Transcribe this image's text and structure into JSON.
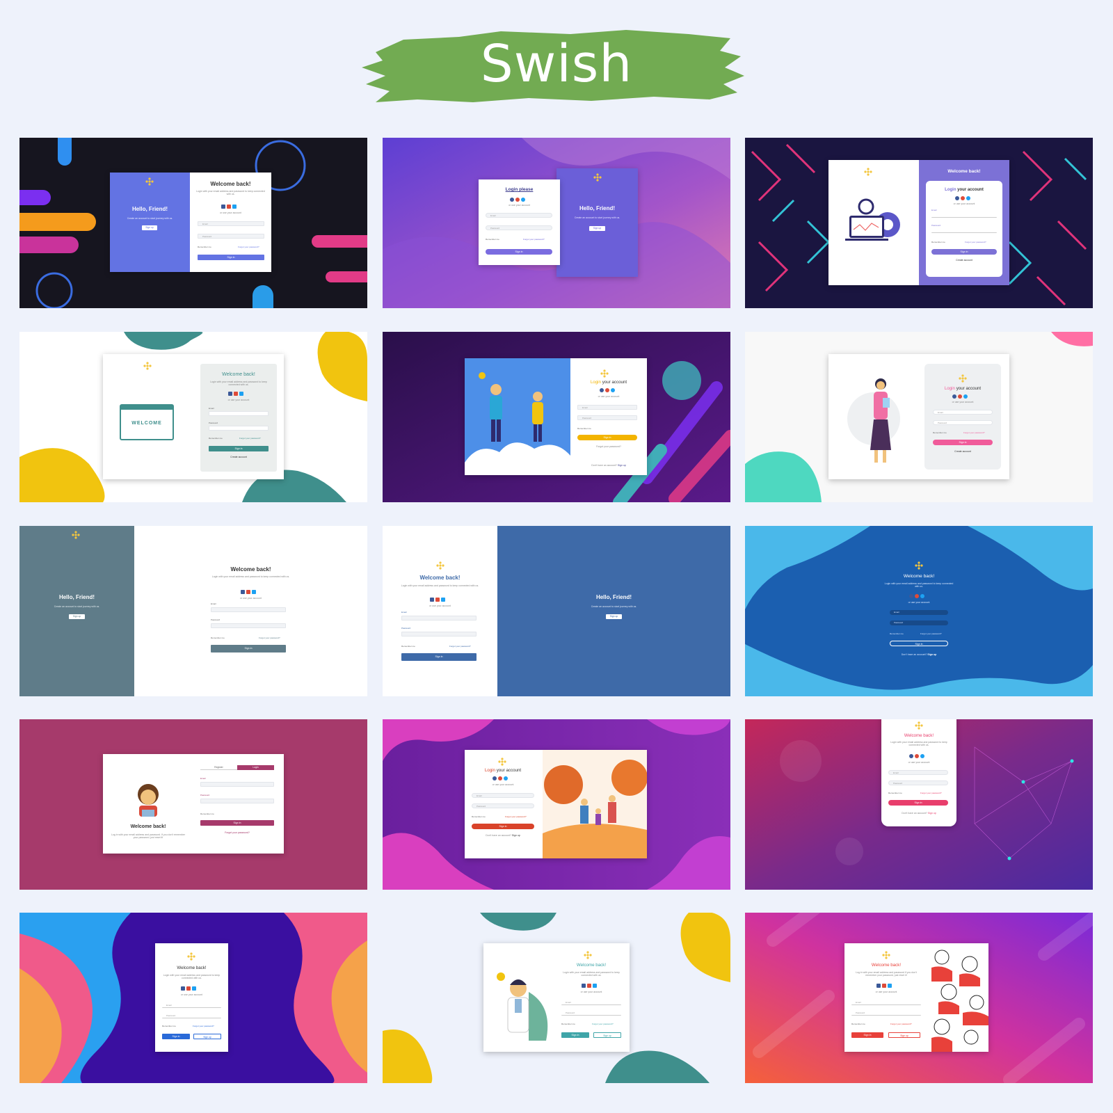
{
  "header": {
    "title": "Swish",
    "brush_color": "#72ab52"
  },
  "social": {
    "fb": "#3b5998",
    "gp": "#dd4b39",
    "tw": "#1da1f2"
  },
  "t1": {
    "panel_title": "Hello, Friend!",
    "panel_sub": "Create an account to start journey with us.",
    "panel_btn": "Sign up",
    "title": "Welcome back!",
    "sub": "Login with your email address and password to keep connected with us.",
    "or": "or use your account",
    "email": "Email",
    "password": "Password",
    "remember": "Remember me",
    "forgot": "Forgot your password?",
    "signin": "Sign in"
  },
  "t2": {
    "title": "Login please",
    "or": "or use your account",
    "email": "Email",
    "password": "Password",
    "remember": "Remember me",
    "forgot": "Forgot your password?",
    "signin": "Sign in",
    "panel_title": "Hello, Friend!",
    "panel_sub": "Create an account to start journey with us.",
    "panel_btn": "Sign up"
  },
  "t3": {
    "panel_title": "Welcome back!",
    "title_a": "Login",
    "title_b": " your account",
    "or": "or use your account",
    "email": "Email",
    "password": "Password",
    "remember": "Remember me",
    "forgot": "Forgot your password?",
    "signin": "Sign in",
    "create": "Create account"
  },
  "t4": {
    "welcome": "WELCOME",
    "title": "Welcome back!",
    "sub": "Login with your email address and password to keep connected with us.",
    "or": "or use your account",
    "email": "Email",
    "password": "Password",
    "remember": "Remember me",
    "forgot": "Forgot your password?",
    "signin": "Sign in",
    "create": "Create account"
  },
  "t5": {
    "title_a": "Login",
    "title_b": " your account",
    "or": "or use your account",
    "email": "Email",
    "password": "Password",
    "remember": "Remember me",
    "signin": "Sign in",
    "forgot": "Forgot your password?",
    "noacc": "Don't have an account?",
    "signup": "Sign up"
  },
  "t6": {
    "title_a": "Login",
    "title_b": " your account",
    "or": "or use your account",
    "email": "Email",
    "password": "Password",
    "remember": "Remember me",
    "forgot": "Forgot your password?",
    "signin": "Sign in",
    "create": "Create account"
  },
  "t7": {
    "panel_title": "Hello, Friend!",
    "panel_sub": "Create an account to start journey with us.",
    "panel_btn": "Sign up",
    "title": "Welcome back!",
    "sub": "Login with your email address and password to keep connected with us.",
    "or": "or use your account",
    "email": "Email",
    "password": "Password",
    "remember": "Remember me",
    "forgot": "Forgot your password?",
    "signin": "Sign in"
  },
  "t8": {
    "title": "Welcome back!",
    "sub": "Login with your email address and password to keep connected with us.",
    "or": "or use your account",
    "email": "Email",
    "password": "Password",
    "remember": "Remember me",
    "forgot": "Forgot your password?",
    "signin": "Sign in",
    "panel_title": "Hello, Friend!",
    "panel_sub": "Create an account to start journey with us.",
    "panel_btn": "Sign up"
  },
  "t9": {
    "title": "Welcome back!",
    "sub": "Login with your email address and password to keep connected with us.",
    "or": "or use your account",
    "email": "Email",
    "password": "Password",
    "remember": "Remember me",
    "forgot": "Forgot your password?",
    "signin": "Sign in",
    "noacc": "Don't have an account?",
    "signup": "Sign up"
  },
  "t10": {
    "tab_register": "Register",
    "tab_login": "Login",
    "email": "Email",
    "password": "Password",
    "remember": "Remember me",
    "signin": "Sign in",
    "forgot": "Forgot your password?",
    "title": "Welcome back!",
    "sub": "Log in with your email address and password. If you don't remember your password, just reset it!"
  },
  "t11": {
    "title_a": "Login",
    "title_b": " your account",
    "or": "or use your account",
    "email": "Email",
    "password": "Password",
    "remember": "Remember me",
    "forgot": "Forgot your password?",
    "signin": "Sign in",
    "noacc": "Don't have an account?",
    "signup": "Sign up"
  },
  "t12": {
    "title": "Welcome back!",
    "sub": "Login with your email address and password to keep connected with us.",
    "or": "or use your account",
    "email": "Email",
    "password": "Password",
    "remember": "Remember me",
    "forgot": "Forgot your password?",
    "signin": "Sign in",
    "noacc": "Don't have an account?",
    "signup": "Sign up"
  },
  "t13": {
    "title": "Welcome back!",
    "sub": "Login with your email address and password to keep connected with us.",
    "or": "or use your account",
    "email": "Email",
    "password": "Password",
    "remember": "Remember me",
    "forgot": "Forgot your password?",
    "signin": "Sign in",
    "signup": "Sign up"
  },
  "t14": {
    "title": "Welcome back!",
    "sub": "Login with your email address and password to keep connected with us.",
    "or": "or use your account",
    "email": "Email",
    "password": "Password",
    "remember": "Remember me",
    "forgot": "Forgot your password?",
    "signin": "Sign in",
    "signup": "Sign up"
  },
  "t15": {
    "title": "Welcome back!",
    "sub": "Log in with your email address and password if you don't remember your password, just reset it!",
    "or": "or use your account",
    "email": "Email",
    "password": "Password",
    "remember": "Remember me",
    "forgot": "Forgot your password?",
    "signin": "Sign in",
    "signup": "Sign up"
  }
}
